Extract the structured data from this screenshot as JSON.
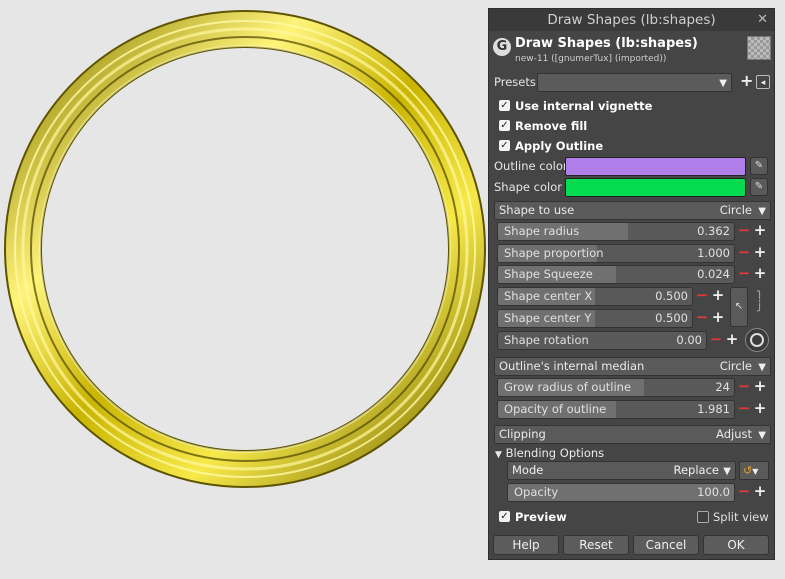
{
  "dialog": {
    "window_title": "Draw Shapes (lb:shapes)",
    "title": "Draw Shapes (lb:shapes)",
    "subtitle": "new-11 ([gnumerTux] (imported))",
    "presets_label": "Presets:",
    "presets_value": ""
  },
  "checks": {
    "vignette": "Use internal vignette",
    "remove_fill": "Remove fill",
    "apply_outline": "Apply Outline"
  },
  "colors": {
    "outline_label": "Outline color",
    "outline_value": "#b07ee8",
    "shape_label": "Shape color",
    "shape_value": "#05dc4f"
  },
  "shape_to_use": {
    "label": "Shape to use",
    "value": "Circle"
  },
  "sliders": {
    "radius": {
      "label": "Shape radius",
      "value": "0.362",
      "fraction": 0.55
    },
    "proportion": {
      "label": "Shape proportion",
      "value": "1.000",
      "fraction": 0.42
    },
    "squeeze": {
      "label": "Shape Squeeze",
      "value": "0.024",
      "fraction": 0.5
    },
    "center_x": {
      "label": "Shape center X",
      "value": "0.500",
      "fraction": 0.5
    },
    "center_y": {
      "label": "Shape center Y",
      "value": "0.500",
      "fraction": 0.5
    },
    "rotation": {
      "label": "Shape rotation",
      "value": "0.00",
      "fraction": 0.0
    },
    "grow": {
      "label": "Grow radius of outline",
      "value": "24",
      "fraction": 0.62
    },
    "opacity_outline": {
      "label": "Opacity of outline",
      "value": "1.981",
      "fraction": 0.5
    },
    "blend_opacity": {
      "label": "Opacity",
      "value": "100.0",
      "fraction": 1.0
    }
  },
  "median": {
    "label": "Outline's internal median",
    "value": "Circle"
  },
  "clipping": {
    "label": "Clipping",
    "value": "Adjust"
  },
  "blending": {
    "title": "Blending Options",
    "mode_label": "Mode",
    "mode_value": "Replace"
  },
  "preview": {
    "label": "Preview",
    "split_label": "Split view"
  },
  "buttons": {
    "help": "Help",
    "reset": "Reset",
    "cancel": "Cancel",
    "ok": "OK"
  },
  "canvas_ring_color": "#d8c600"
}
